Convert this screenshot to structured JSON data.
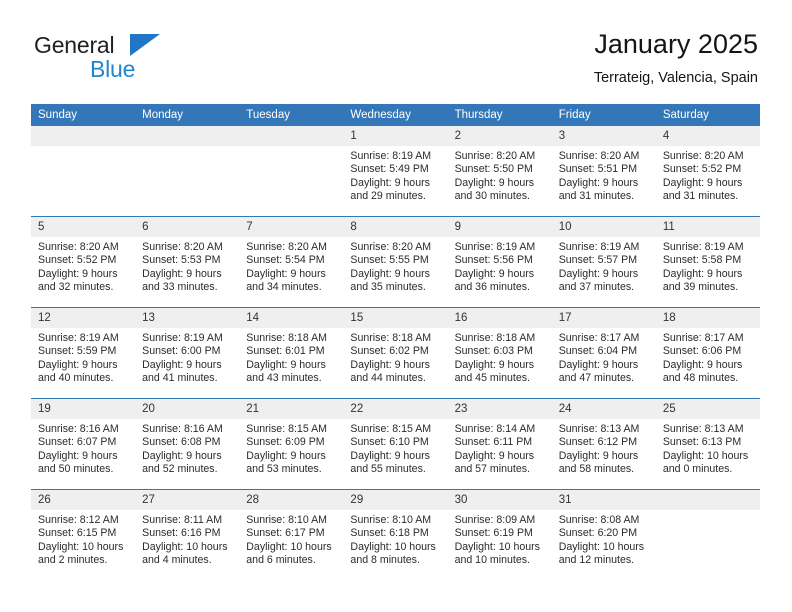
{
  "brand": {
    "name_part1": "General",
    "name_part2": "Blue",
    "logo_icon": "triangle-logo-icon"
  },
  "header": {
    "title": "January 2025",
    "subtitle": "Terrateig, Valencia, Spain"
  },
  "calendar": {
    "weekday_headers": [
      "Sunday",
      "Monday",
      "Tuesday",
      "Wednesday",
      "Thursday",
      "Friday",
      "Saturday"
    ],
    "accent_color": "#3477b8",
    "daynum_band_color": "#efefef",
    "weeks": [
      [
        {
          "day": "",
          "empty": true
        },
        {
          "day": "",
          "empty": true
        },
        {
          "day": "",
          "empty": true
        },
        {
          "day": "1",
          "sunrise": "Sunrise: 8:19 AM",
          "sunset": "Sunset: 5:49 PM",
          "daylight_line1": "Daylight: 9 hours",
          "daylight_line2": "and 29 minutes."
        },
        {
          "day": "2",
          "sunrise": "Sunrise: 8:20 AM",
          "sunset": "Sunset: 5:50 PM",
          "daylight_line1": "Daylight: 9 hours",
          "daylight_line2": "and 30 minutes."
        },
        {
          "day": "3",
          "sunrise": "Sunrise: 8:20 AM",
          "sunset": "Sunset: 5:51 PM",
          "daylight_line1": "Daylight: 9 hours",
          "daylight_line2": "and 31 minutes."
        },
        {
          "day": "4",
          "sunrise": "Sunrise: 8:20 AM",
          "sunset": "Sunset: 5:52 PM",
          "daylight_line1": "Daylight: 9 hours",
          "daylight_line2": "and 31 minutes."
        }
      ],
      [
        {
          "day": "5",
          "sunrise": "Sunrise: 8:20 AM",
          "sunset": "Sunset: 5:52 PM",
          "daylight_line1": "Daylight: 9 hours",
          "daylight_line2": "and 32 minutes."
        },
        {
          "day": "6",
          "sunrise": "Sunrise: 8:20 AM",
          "sunset": "Sunset: 5:53 PM",
          "daylight_line1": "Daylight: 9 hours",
          "daylight_line2": "and 33 minutes."
        },
        {
          "day": "7",
          "sunrise": "Sunrise: 8:20 AM",
          "sunset": "Sunset: 5:54 PM",
          "daylight_line1": "Daylight: 9 hours",
          "daylight_line2": "and 34 minutes."
        },
        {
          "day": "8",
          "sunrise": "Sunrise: 8:20 AM",
          "sunset": "Sunset: 5:55 PM",
          "daylight_line1": "Daylight: 9 hours",
          "daylight_line2": "and 35 minutes."
        },
        {
          "day": "9",
          "sunrise": "Sunrise: 8:19 AM",
          "sunset": "Sunset: 5:56 PM",
          "daylight_line1": "Daylight: 9 hours",
          "daylight_line2": "and 36 minutes."
        },
        {
          "day": "10",
          "sunrise": "Sunrise: 8:19 AM",
          "sunset": "Sunset: 5:57 PM",
          "daylight_line1": "Daylight: 9 hours",
          "daylight_line2": "and 37 minutes."
        },
        {
          "day": "11",
          "sunrise": "Sunrise: 8:19 AM",
          "sunset": "Sunset: 5:58 PM",
          "daylight_line1": "Daylight: 9 hours",
          "daylight_line2": "and 39 minutes."
        }
      ],
      [
        {
          "day": "12",
          "sunrise": "Sunrise: 8:19 AM",
          "sunset": "Sunset: 5:59 PM",
          "daylight_line1": "Daylight: 9 hours",
          "daylight_line2": "and 40 minutes."
        },
        {
          "day": "13",
          "sunrise": "Sunrise: 8:19 AM",
          "sunset": "Sunset: 6:00 PM",
          "daylight_line1": "Daylight: 9 hours",
          "daylight_line2": "and 41 minutes."
        },
        {
          "day": "14",
          "sunrise": "Sunrise: 8:18 AM",
          "sunset": "Sunset: 6:01 PM",
          "daylight_line1": "Daylight: 9 hours",
          "daylight_line2": "and 43 minutes."
        },
        {
          "day": "15",
          "sunrise": "Sunrise: 8:18 AM",
          "sunset": "Sunset: 6:02 PM",
          "daylight_line1": "Daylight: 9 hours",
          "daylight_line2": "and 44 minutes."
        },
        {
          "day": "16",
          "sunrise": "Sunrise: 8:18 AM",
          "sunset": "Sunset: 6:03 PM",
          "daylight_line1": "Daylight: 9 hours",
          "daylight_line2": "and 45 minutes."
        },
        {
          "day": "17",
          "sunrise": "Sunrise: 8:17 AM",
          "sunset": "Sunset: 6:04 PM",
          "daylight_line1": "Daylight: 9 hours",
          "daylight_line2": "and 47 minutes."
        },
        {
          "day": "18",
          "sunrise": "Sunrise: 8:17 AM",
          "sunset": "Sunset: 6:06 PM",
          "daylight_line1": "Daylight: 9 hours",
          "daylight_line2": "and 48 minutes."
        }
      ],
      [
        {
          "day": "19",
          "sunrise": "Sunrise: 8:16 AM",
          "sunset": "Sunset: 6:07 PM",
          "daylight_line1": "Daylight: 9 hours",
          "daylight_line2": "and 50 minutes."
        },
        {
          "day": "20",
          "sunrise": "Sunrise: 8:16 AM",
          "sunset": "Sunset: 6:08 PM",
          "daylight_line1": "Daylight: 9 hours",
          "daylight_line2": "and 52 minutes."
        },
        {
          "day": "21",
          "sunrise": "Sunrise: 8:15 AM",
          "sunset": "Sunset: 6:09 PM",
          "daylight_line1": "Daylight: 9 hours",
          "daylight_line2": "and 53 minutes."
        },
        {
          "day": "22",
          "sunrise": "Sunrise: 8:15 AM",
          "sunset": "Sunset: 6:10 PM",
          "daylight_line1": "Daylight: 9 hours",
          "daylight_line2": "and 55 minutes."
        },
        {
          "day": "23",
          "sunrise": "Sunrise: 8:14 AM",
          "sunset": "Sunset: 6:11 PM",
          "daylight_line1": "Daylight: 9 hours",
          "daylight_line2": "and 57 minutes."
        },
        {
          "day": "24",
          "sunrise": "Sunrise: 8:13 AM",
          "sunset": "Sunset: 6:12 PM",
          "daylight_line1": "Daylight: 9 hours",
          "daylight_line2": "and 58 minutes."
        },
        {
          "day": "25",
          "sunrise": "Sunrise: 8:13 AM",
          "sunset": "Sunset: 6:13 PM",
          "daylight_line1": "Daylight: 10 hours",
          "daylight_line2": "and 0 minutes."
        }
      ],
      [
        {
          "day": "26",
          "sunrise": "Sunrise: 8:12 AM",
          "sunset": "Sunset: 6:15 PM",
          "daylight_line1": "Daylight: 10 hours",
          "daylight_line2": "and 2 minutes."
        },
        {
          "day": "27",
          "sunrise": "Sunrise: 8:11 AM",
          "sunset": "Sunset: 6:16 PM",
          "daylight_line1": "Daylight: 10 hours",
          "daylight_line2": "and 4 minutes."
        },
        {
          "day": "28",
          "sunrise": "Sunrise: 8:10 AM",
          "sunset": "Sunset: 6:17 PM",
          "daylight_line1": "Daylight: 10 hours",
          "daylight_line2": "and 6 minutes."
        },
        {
          "day": "29",
          "sunrise": "Sunrise: 8:10 AM",
          "sunset": "Sunset: 6:18 PM",
          "daylight_line1": "Daylight: 10 hours",
          "daylight_line2": "and 8 minutes."
        },
        {
          "day": "30",
          "sunrise": "Sunrise: 8:09 AM",
          "sunset": "Sunset: 6:19 PM",
          "daylight_line1": "Daylight: 10 hours",
          "daylight_line2": "and 10 minutes."
        },
        {
          "day": "31",
          "sunrise": "Sunrise: 8:08 AM",
          "sunset": "Sunset: 6:20 PM",
          "daylight_line1": "Daylight: 10 hours",
          "daylight_line2": "and 12 minutes."
        },
        {
          "day": "",
          "empty": true
        }
      ]
    ]
  }
}
